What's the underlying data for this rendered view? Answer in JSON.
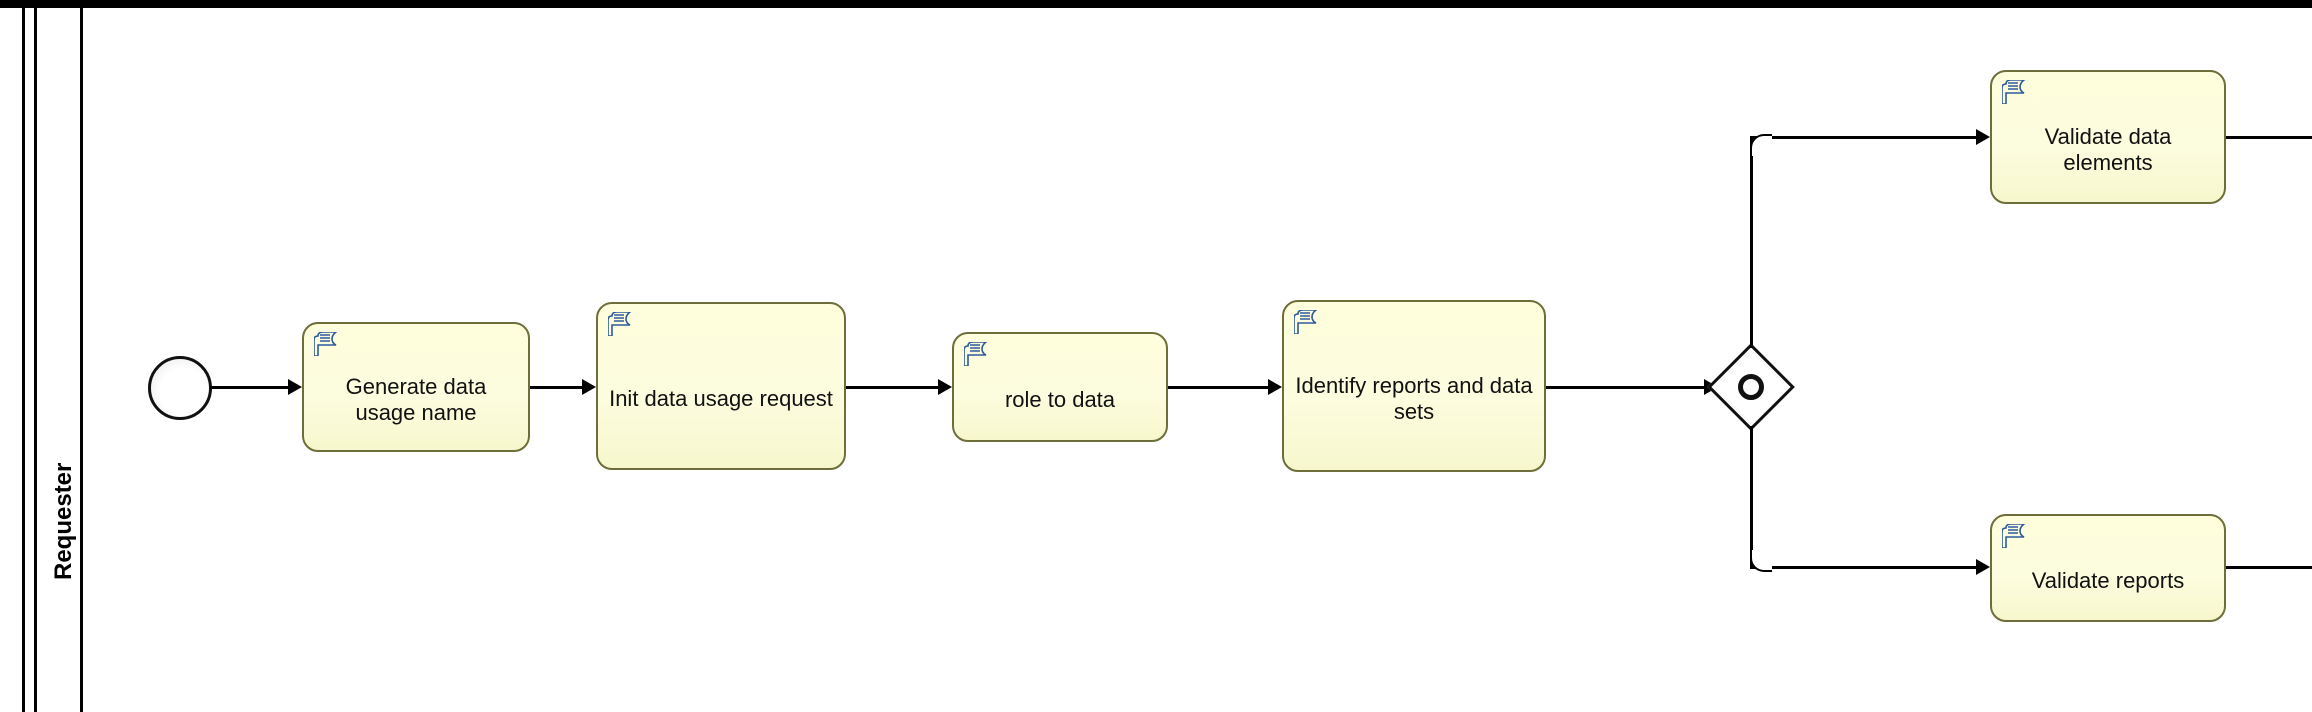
{
  "lane": {
    "label": "Requester"
  },
  "tasks": {
    "generate": {
      "label": "Generate data usage name"
    },
    "init": {
      "label": "Init data usage request"
    },
    "role": {
      "label": "role to data"
    },
    "identify": {
      "label": "Identify reports and data sets"
    },
    "validate_elems": {
      "label": "Validate data elements"
    },
    "validate_reports": {
      "label": "Validate reports"
    }
  }
}
